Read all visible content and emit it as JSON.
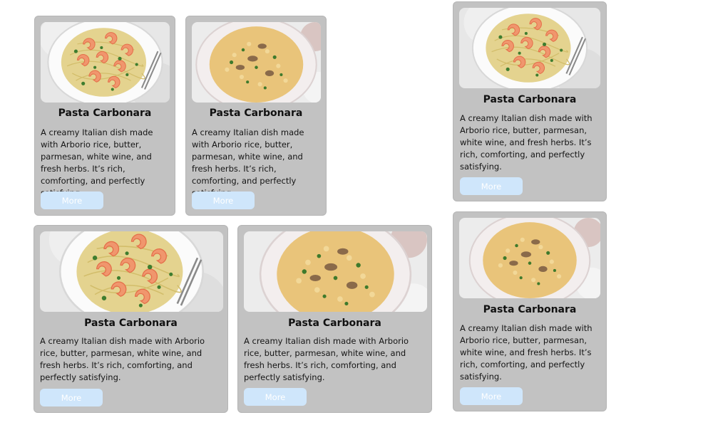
{
  "cards": [
    {
      "image": "shrimp-pasta",
      "title": "Pasta Carbonara",
      "description": "A creamy Italian dish made with Arborio rice, butter, parmesan, white wine, and fresh herbs. It’s rich, comforting, and perfectly satisfying.",
      "button_label": "More"
    },
    {
      "image": "mushroom-risotto",
      "title": "Pasta Carbonara",
      "description": "A creamy Italian dish made with Arborio rice, butter, parmesan, white wine, and fresh herbs. It’s rich, comforting, and perfectly satisfying.",
      "button_label": "More"
    },
    {
      "image": "shrimp-pasta",
      "title": "Pasta Carbonara",
      "description": "A creamy Italian dish made with Arborio rice, butter, parmesan, white wine, and fresh herbs. It’s rich, comforting, and perfectly satisfying.",
      "button_label": "More"
    },
    {
      "image": "shrimp-pasta",
      "title": "Pasta Carbonara",
      "description": "A creamy Italian dish made with Arborio rice, butter, parmesan, white wine, and fresh herbs. It’s rich, comforting, and perfectly satisfying.",
      "button_label": "More"
    },
    {
      "image": "mushroom-risotto",
      "title": "Pasta Carbonara",
      "description": "A creamy Italian dish made with Arborio rice, butter, parmesan, white wine, and fresh herbs. It’s rich, comforting, and perfectly satisfying.",
      "button_label": "More"
    },
    {
      "image": "mushroom-risotto",
      "title": "Pasta Carbonara",
      "description": "A creamy Italian dish made with Arborio rice, butter, parmesan, white wine, and fresh herbs. It’s rich, comforting, and perfectly satisfying.",
      "button_label": "More"
    }
  ],
  "colors": {
    "card_background": "#c2c2c2",
    "button_background": "#cfe6fb",
    "button_text": "#ffffff"
  }
}
